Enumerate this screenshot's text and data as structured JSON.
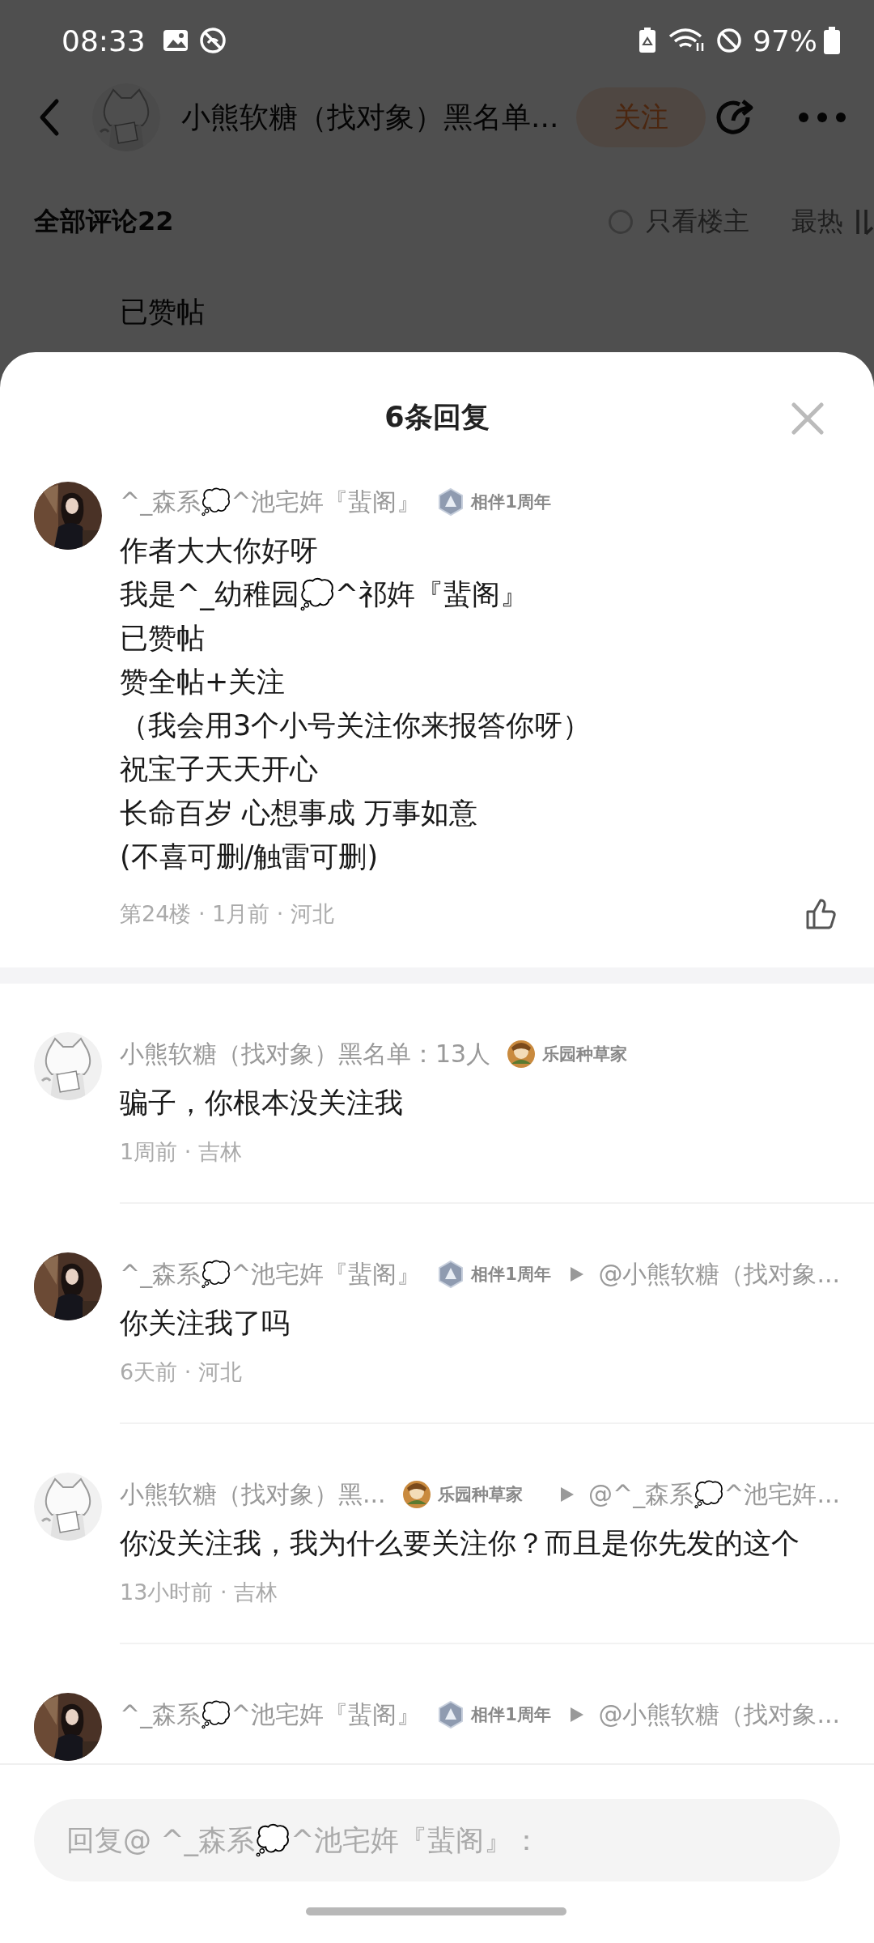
{
  "status_bar": {
    "time": "08:33",
    "battery": "97%"
  },
  "header": {
    "title": "小熊软糖（找对象）黑名单...",
    "follow_button": "关注"
  },
  "comments_bar": {
    "title": "全部评论22",
    "owner_only": {
      "label": "只看楼主",
      "checked": false
    },
    "sort": "最热"
  },
  "background_comment": {
    "lines": [
      "已赞帖"
    ]
  },
  "sheet": {
    "title": "6条回复",
    "comments": [
      {
        "kind": "main",
        "author": "^_森系💭^池宅姩『蜚阁』",
        "badge": {
          "kind": "anniversary",
          "label": "相伴1周年"
        },
        "lines": [
          "作者大大你好呀",
          "我是^_幼稚园💭^祁姩『蜚阁』",
          "已赞帖",
          "赞全帖+关注",
          "（我会用3个小号关注你来报答你呀）",
          "祝宝子天天开心",
          "长命百岁 心想事成 万事如意",
          "(不喜可删/触雷可删)"
        ],
        "meta": "第24楼 · 1月前 · 河北",
        "liked": false
      },
      {
        "kind": "reply",
        "author": "小熊软糖（找对象）黑名单：13人",
        "badge": {
          "kind": "gardener",
          "label": "乐园种草家"
        },
        "lines": [
          "骗子，你根本没关注我"
        ],
        "meta": "1周前 · 吉林"
      },
      {
        "kind": "reply",
        "author": "^_森系💭^池宅姩『蜚阁』",
        "badge": {
          "kind": "anniversary",
          "label": "相伴1周年"
        },
        "reply_to": "@小熊软糖（找对象...",
        "lines": [
          "你关注我了吗"
        ],
        "meta": "6天前 · 河北"
      },
      {
        "kind": "reply",
        "author": "小熊软糖（找对象）黑...",
        "badge": {
          "kind": "gardener",
          "label": "乐园种草家"
        },
        "reply_to": "@^_森系💭^池宅姩...",
        "lines": [
          "你没关注我，我为什么要关注你？而且是你先发的这个"
        ],
        "meta": "13小时前 · 吉林"
      },
      {
        "kind": "reply",
        "author": "^_森系💭^池宅姩『蜚阁』",
        "badge": {
          "kind": "anniversary",
          "label": "相伴1周年"
        },
        "reply_to": "@小熊软糖（找对象..."
      }
    ]
  },
  "reply_bar": {
    "placeholder": "回复@ ^_森系💭^池宅姩『蜚阁』："
  }
}
